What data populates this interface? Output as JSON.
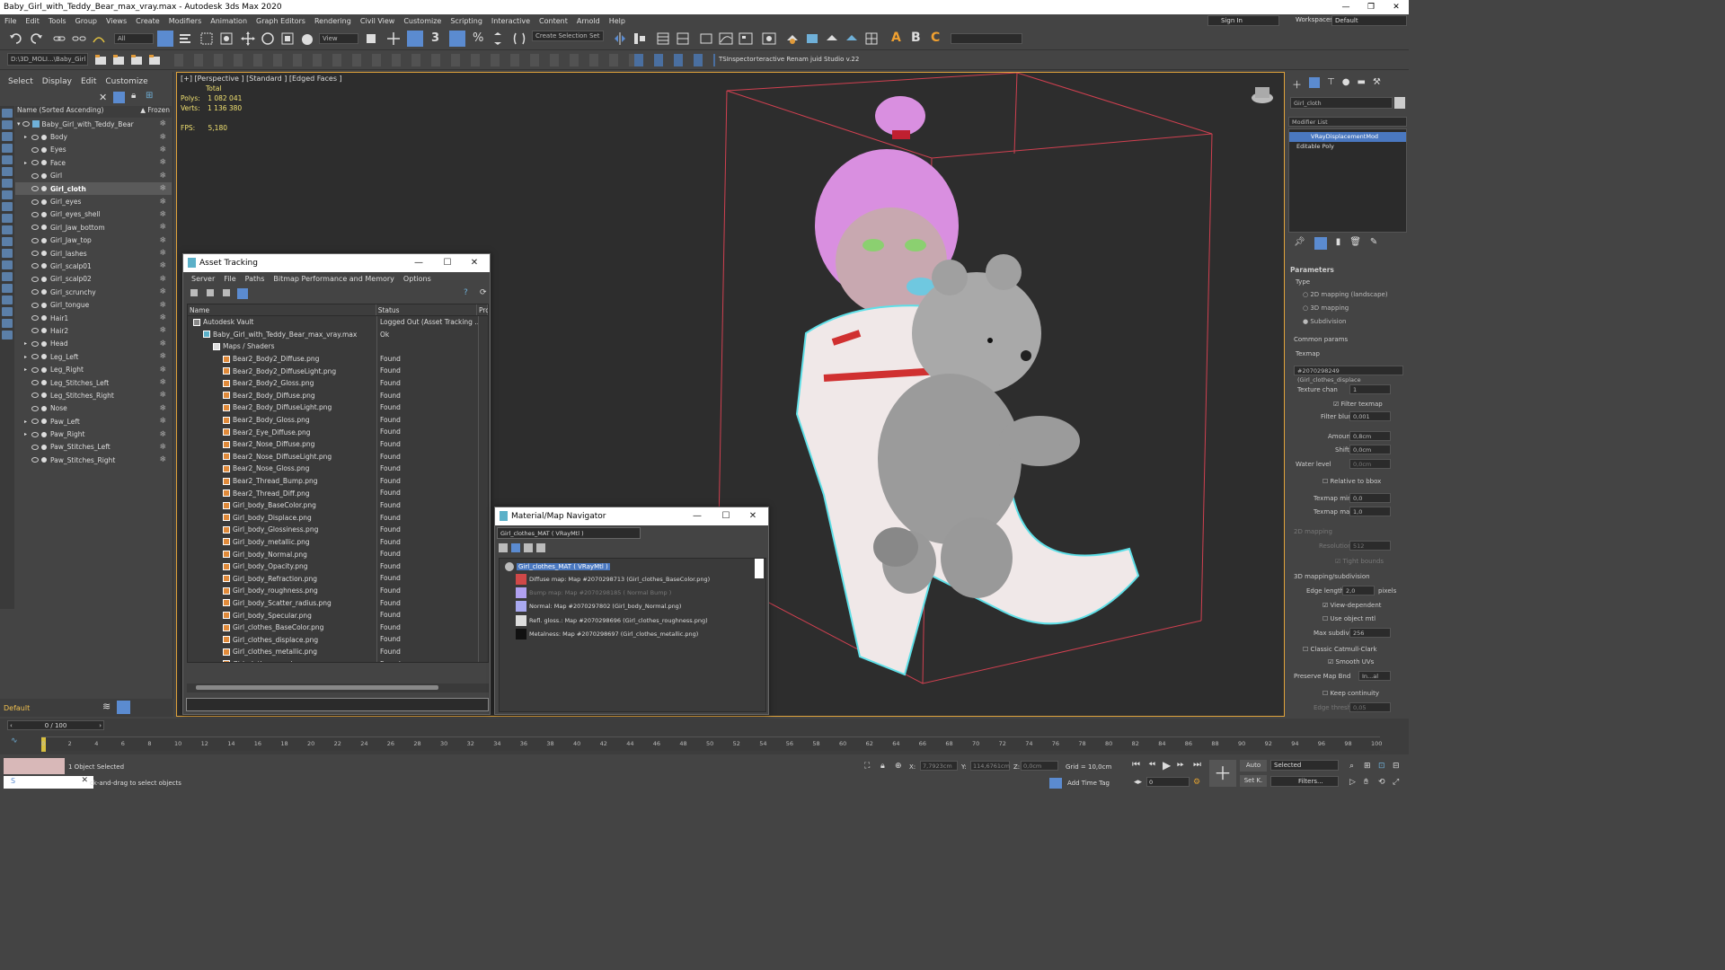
{
  "window": {
    "title": "Baby_Girl_with_Teddy_Bear_max_vray.max - Autodesk 3ds Max 2020",
    "controls": [
      "—",
      "❐",
      "✕"
    ]
  },
  "menu": [
    "File",
    "Edit",
    "Tools",
    "Group",
    "Views",
    "Create",
    "Modifiers",
    "Animation",
    "Graph Editors",
    "Rendering",
    "Civil View",
    "Customize",
    "Scripting",
    "Interactive",
    "Content",
    "Arnold",
    "Help"
  ],
  "account": {
    "sign_in": "Sign In",
    "workspaces_label": "Workspaces:",
    "workspace": "Default"
  },
  "toolbar": {
    "filter": "All",
    "view": "View",
    "selection_set": "Create Selection Set",
    "project_path": "D:\\3D_MOLI...\\Baby_Girl",
    "ts_inspector": "TSInspector",
    "renamer": "teractive Renam juid Studio v.22"
  },
  "scene_explorer": {
    "tabs": [
      "Select",
      "Display",
      "Edit",
      "Customize"
    ],
    "column_name": "Name (Sorted Ascending)",
    "column_frozen": "▲ Frozen",
    "root": "Baby_Girl_with_Teddy_Bear",
    "items": [
      "Body",
      "Eyes",
      "Face",
      "Girl",
      "Girl_cloth",
      "Girl_eyes",
      "Girl_eyes_shell",
      "Girl_Jaw_bottom",
      "Girl_Jaw_top",
      "Girl_lashes",
      "Girl_scalp01",
      "Girl_scalp02",
      "Girl_scrunchy",
      "Girl_tongue",
      "Hair1",
      "Hair2",
      "Head",
      "Leg_Left",
      "Leg_Right",
      "Leg_Stitches_Left",
      "Leg_Stitches_Right",
      "Nose",
      "Paw_Left",
      "Paw_Right",
      "Paw_Stitches_Left",
      "Paw_Stitches_Right"
    ],
    "selected": "Girl_cloth",
    "layer": "Default"
  },
  "viewport": {
    "label": "[+] [Perspective ] [Standard ] [Edged Faces ]",
    "total_label": "Total",
    "polys_label": "Polys:",
    "polys": "1 082 041",
    "verts_label": "Verts:",
    "verts": "1 136 380",
    "fps_label": "FPS:",
    "fps": "5,180"
  },
  "asset_tracking": {
    "title": "Asset Tracking",
    "menu": [
      "Server",
      "File",
      "Paths",
      "Bitmap Performance and Memory",
      "Options"
    ],
    "col_name": "Name",
    "col_status": "Status",
    "col_pro": "Pro",
    "rows": [
      {
        "name": "Autodesk Vault",
        "status": "Logged Out (Asset Tracking ...",
        "indent": 0
      },
      {
        "name": "Baby_Girl_with_Teddy_Bear_max_vray.max",
        "status": "Ok",
        "indent": 1
      },
      {
        "name": "Maps / Shaders",
        "status": "",
        "indent": 2
      },
      {
        "name": "Bear2_Body2_Diffuse.png",
        "status": "Found",
        "indent": 3
      },
      {
        "name": "Bear2_Body2_DiffuseLight.png",
        "status": "Found",
        "indent": 3
      },
      {
        "name": "Bear2_Body2_Gloss.png",
        "status": "Found",
        "indent": 3
      },
      {
        "name": "Bear2_Body_Diffuse.png",
        "status": "Found",
        "indent": 3
      },
      {
        "name": "Bear2_Body_DiffuseLight.png",
        "status": "Found",
        "indent": 3
      },
      {
        "name": "Bear2_Body_Gloss.png",
        "status": "Found",
        "indent": 3
      },
      {
        "name": "Bear2_Eye_Diffuse.png",
        "status": "Found",
        "indent": 3
      },
      {
        "name": "Bear2_Nose_Diffuse.png",
        "status": "Found",
        "indent": 3
      },
      {
        "name": "Bear2_Nose_DiffuseLight.png",
        "status": "Found",
        "indent": 3
      },
      {
        "name": "Bear2_Nose_Gloss.png",
        "status": "Found",
        "indent": 3
      },
      {
        "name": "Bear2_Thread_Bump.png",
        "status": "Found",
        "indent": 3
      },
      {
        "name": "Bear2_Thread_Diff.png",
        "status": "Found",
        "indent": 3
      },
      {
        "name": "Girl_body_BaseColor.png",
        "status": "Found",
        "indent": 3
      },
      {
        "name": "Girl_body_Displace.png",
        "status": "Found",
        "indent": 3
      },
      {
        "name": "Girl_body_Glossiness.png",
        "status": "Found",
        "indent": 3
      },
      {
        "name": "Girl_body_metallic.png",
        "status": "Found",
        "indent": 3
      },
      {
        "name": "Girl_body_Normal.png",
        "status": "Found",
        "indent": 3
      },
      {
        "name": "Girl_body_Opacity.png",
        "status": "Found",
        "indent": 3
      },
      {
        "name": "Girl_body_Refraction.png",
        "status": "Found",
        "indent": 3
      },
      {
        "name": "Girl_body_roughness.png",
        "status": "Found",
        "indent": 3
      },
      {
        "name": "Girl_body_Scatter_radius.png",
        "status": "Found",
        "indent": 3
      },
      {
        "name": "Girl_body_Specular.png",
        "status": "Found",
        "indent": 3
      },
      {
        "name": "Girl_clothes_BaseColor.png",
        "status": "Found",
        "indent": 3
      },
      {
        "name": "Girl_clothes_displace.png",
        "status": "Found",
        "indent": 3
      },
      {
        "name": "Girl_clothes_metallic.png",
        "status": "Found",
        "indent": 3
      },
      {
        "name": "Girl_clothes_roughness.png",
        "status": "Found",
        "indent": 3
      }
    ]
  },
  "material_navigator": {
    "title": "Material/Map Navigator",
    "field": "Girl_clothes_MAT  ( VRayMtl )",
    "root": "Girl_clothes_MAT  ( VRayMtl )",
    "maps": [
      {
        "text": "Diffuse map: Map #2070298713 (Girl_clothes_BaseColor.png)",
        "dim": false
      },
      {
        "text": "Bump map: Map #2070298185  ( Normal Bump )",
        "dim": true
      },
      {
        "text": "Normal: Map #2070297802 (Girl_body_Normal.png)",
        "dim": false
      },
      {
        "text": "Refl. gloss.: Map #2070298696 (Girl_clothes_roughness.png)",
        "dim": false
      },
      {
        "text": "Metalness: Map #2070298697 (Girl_clothes_metallic.png)",
        "dim": false
      }
    ]
  },
  "command_panel": {
    "object_name": "Girl_cloth",
    "modifier_list": "Modifier List",
    "stack": [
      "VRayDisplacementMod",
      "Editable Poly"
    ],
    "params_title": "Parameters",
    "type_label": "Type",
    "type_options": [
      "2D mapping (landscape)",
      "3D mapping",
      "Subdivision"
    ],
    "common_params": "Common params",
    "texmap_label": "Texmap",
    "texmap_value": "#2070298249 (Girl_clothes_displace",
    "texture_chan_label": "Texture chan",
    "texture_chan": "1",
    "filter_texmap": "Filter texmap",
    "filter_blur_label": "Filter blur",
    "filter_blur": "0,001",
    "amount_label": "Amount",
    "amount": "0,8cm",
    "shift_label": "Shift",
    "shift": "0,0cm",
    "water_level_label": "Water level",
    "water_level": "0,0cm",
    "relative_bbox": "Relative to bbox",
    "texmap_min_label": "Texmap min",
    "texmap_min": "0,0",
    "texmap_max_label": "Texmap max",
    "texmap_max": "1,0",
    "mapping2d": "2D mapping",
    "resolution_label": "Resolution",
    "resolution": "512",
    "tight_bounds": "Tight bounds",
    "mapping3d": "3D mapping/subdivision",
    "edge_length_label": "Edge length",
    "edge_length": "2,0",
    "pixels": "pixels",
    "view_dependent": "View-dependent",
    "use_object_mtl": "Use object mtl",
    "max_subdivs_label": "Max subdivs",
    "max_subdivs": "256",
    "classic_catmull": "Classic Catmull-Clark",
    "smooth_uvs": "Smooth UVs",
    "preserve_map_label": "Preserve Map Bnd",
    "preserve_map": "In...al",
    "keep_continuity": "Keep continuity",
    "edge_thresh_label": "Edge thresh",
    "edge_thresh": "0,05"
  },
  "timeline": {
    "frame": "0 / 100",
    "ticks": [
      "0",
      "2",
      "4",
      "6",
      "8",
      "10",
      "12",
      "14",
      "16",
      "18",
      "20",
      "22",
      "24",
      "26",
      "28",
      "30",
      "32",
      "34",
      "36",
      "38",
      "40",
      "42",
      "44",
      "46",
      "48",
      "50",
      "52",
      "54",
      "56",
      "58",
      "60",
      "62",
      "64",
      "66",
      "68",
      "70",
      "72",
      "74",
      "76",
      "78",
      "80",
      "82",
      "84",
      "86",
      "88",
      "90",
      "92",
      "94",
      "96",
      "98",
      "100"
    ]
  },
  "status_bar": {
    "selected": "1 Object Selected",
    "prompt": "ck-and-drag to select objects",
    "x_label": "X:",
    "x": "7,7923cm",
    "y_label": "Y:",
    "y": "114,6761cm",
    "z_label": "Z:",
    "z": "0,0cm",
    "grid": "Grid = 10,0cm",
    "add_time_tag": "Add Time Tag",
    "auto": "Auto",
    "set_k": "Set K.",
    "selected_mode": "Selected",
    "filters": "Filters...",
    "frame_field": "0"
  }
}
